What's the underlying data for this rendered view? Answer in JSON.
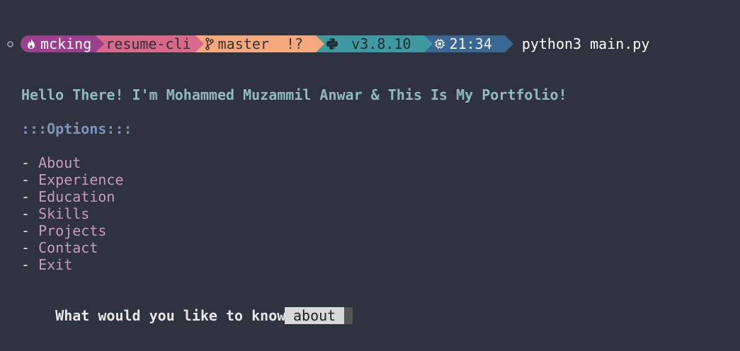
{
  "prompt": {
    "user": "mcking",
    "directory": "resume-cli",
    "branch": "master",
    "git_status": "!?",
    "python_version": "v3.8.10",
    "time": "21:34",
    "command": "python3 main.py",
    "icons": {
      "user": "flame-icon",
      "branch": "git-branch-icon",
      "python": "python-icon",
      "time": "cpu-icon"
    }
  },
  "app": {
    "greeting": "Hello There! I'm Mohammed Muzammil Anwar & This Is My Portfolio!",
    "options_title": ":::Options:::",
    "bullet": "- ",
    "options": [
      {
        "label": "About"
      },
      {
        "label": "Experience"
      },
      {
        "label": "Education"
      },
      {
        "label": "Skills"
      },
      {
        "label": "Projects"
      },
      {
        "label": "Contact"
      },
      {
        "label": "Exit"
      }
    ],
    "question": "What would you like to know?: ",
    "input_value": "a",
    "suggestions": [
      {
        "label": "about"
      }
    ]
  },
  "colors": {
    "background": "#2f333f",
    "greeting": "#8fbcbb",
    "options_title": "#7f93b8",
    "option_name": "#c79cb7"
  }
}
